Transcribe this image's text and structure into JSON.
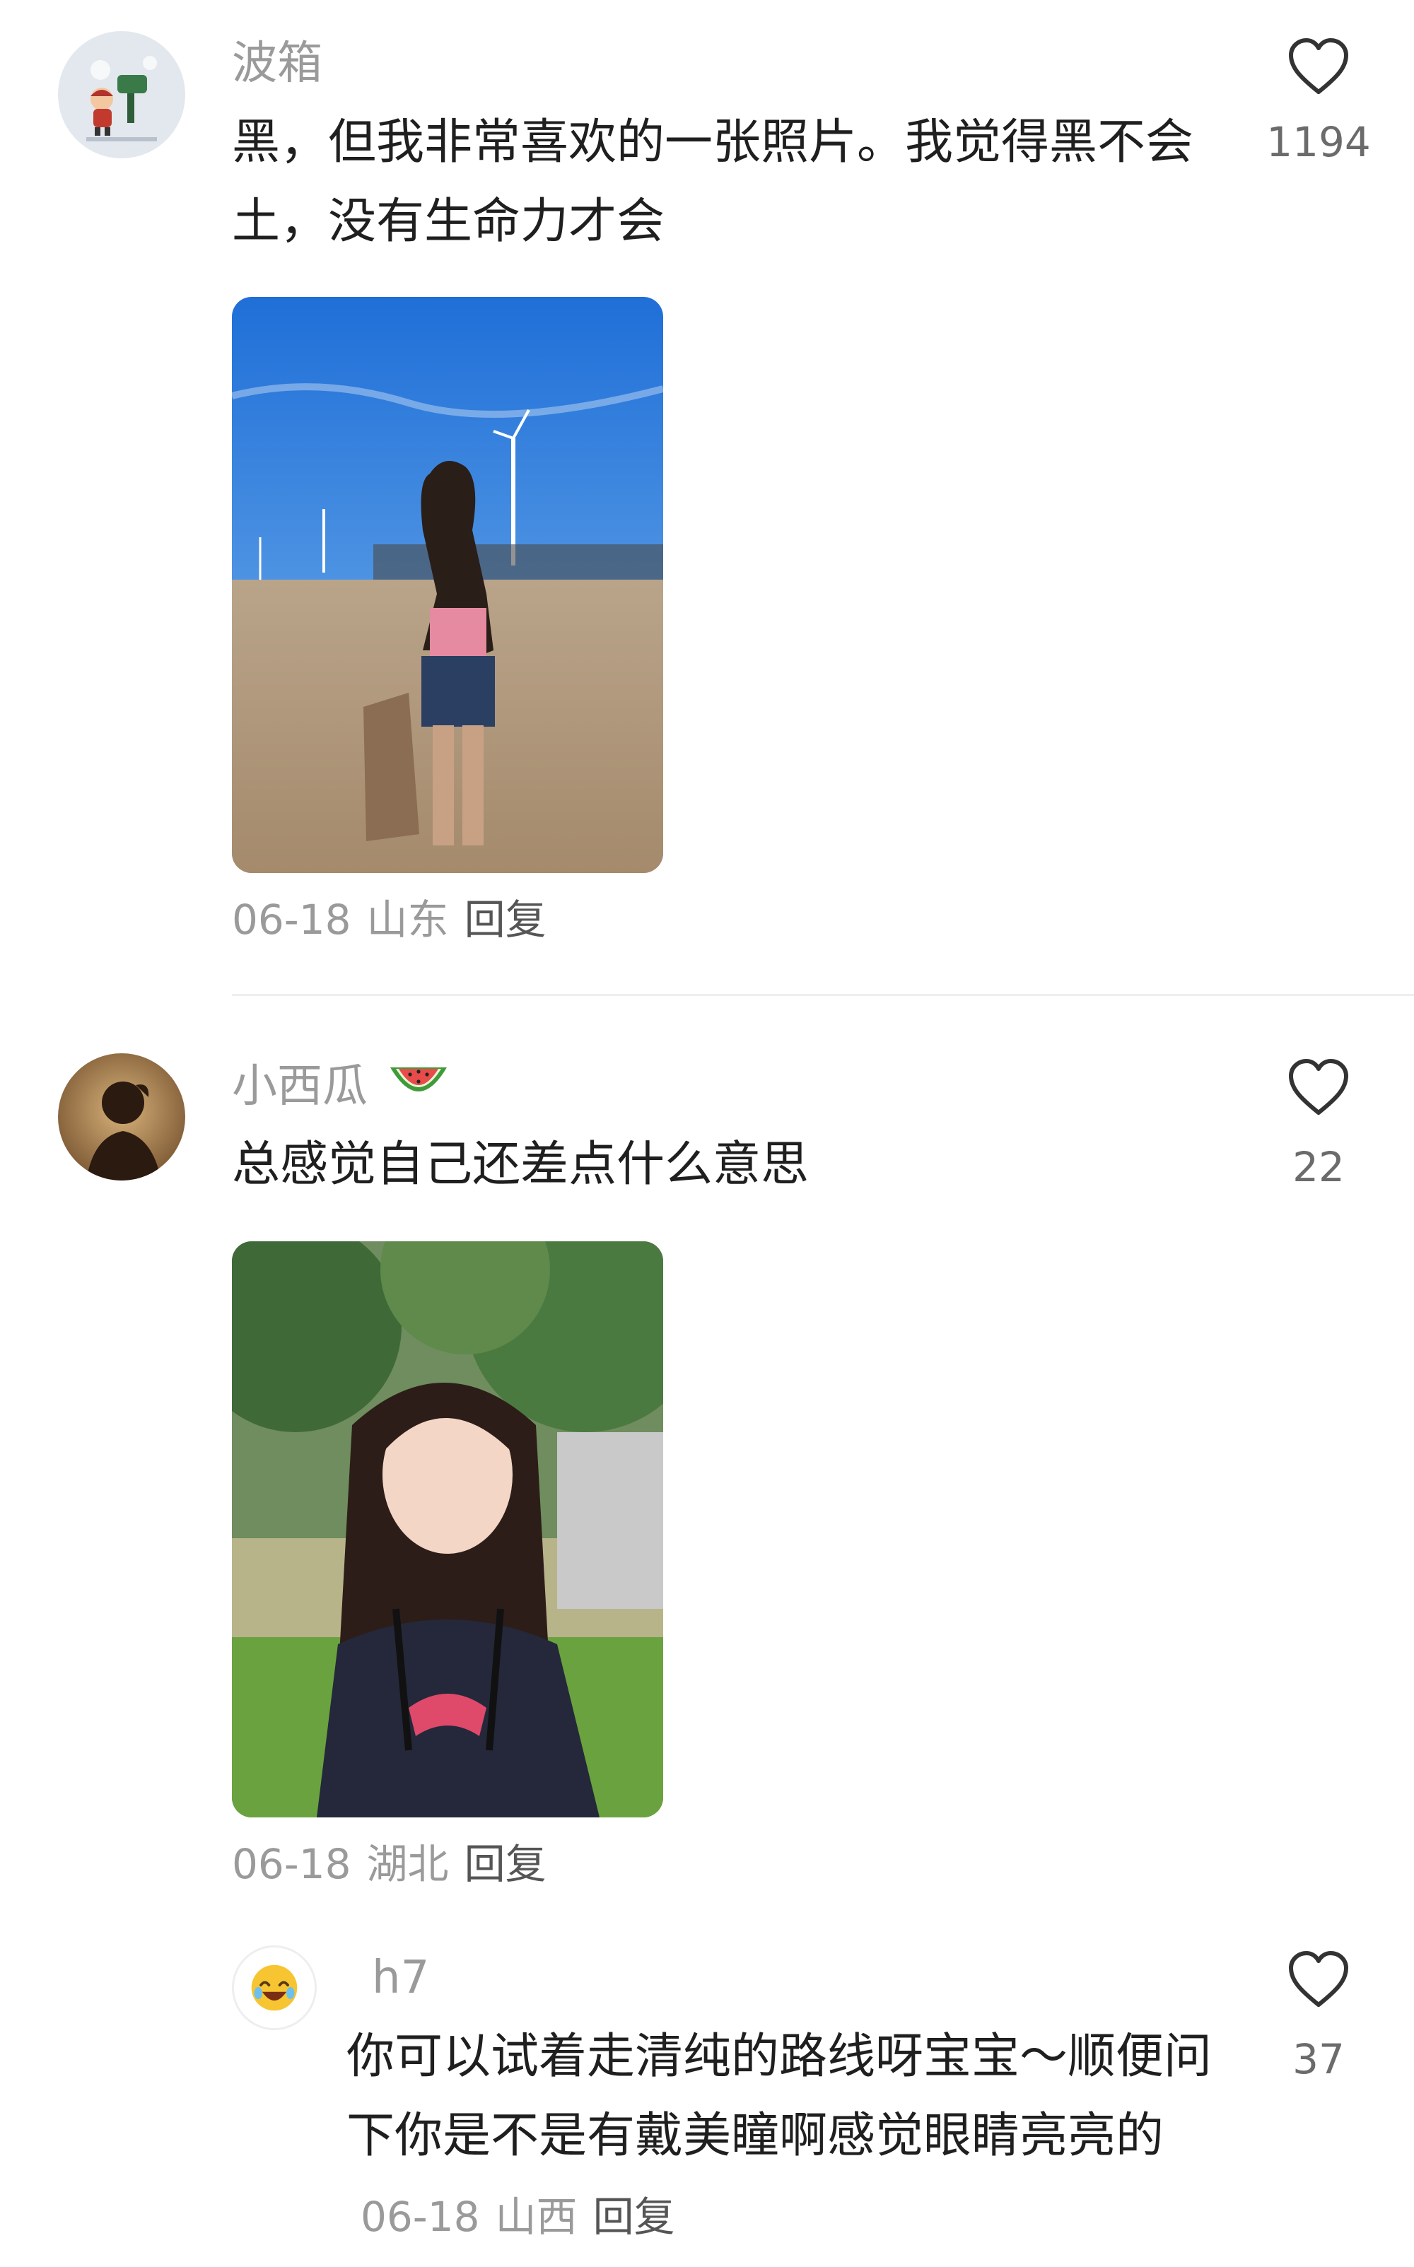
{
  "comments": [
    {
      "username": "波箱",
      "avatar_icon": "cartoon-mailbox-avatar",
      "text": "黑，但我非常喜欢的一张照片。我觉得黑不会土，没有生命力才会",
      "image_alt": "beach-photo-with-wind-turbines",
      "date": "06-18",
      "location": "山东",
      "reply_label": "回复",
      "like_icon": "heart-outline-icon",
      "likes": "1194"
    },
    {
      "username": "小西瓜",
      "username_emoji": "watermelon-icon",
      "avatar_icon": "silhouette-avatar",
      "text": "总感觉自己还差点什么意思",
      "image_alt": "portrait-photo-in-garden",
      "date": "06-18",
      "location": "湖北",
      "reply_label": "回复",
      "like_icon": "heart-outline-icon",
      "likes": "22",
      "replies": [
        {
          "username": "h7",
          "avatar_icon": "laughing-emoji-avatar",
          "text": "你可以试着走清纯的路线呀宝宝～顺便问下你是不是有戴美瞳啊感觉眼睛亮亮的",
          "date": "06-18",
          "location": "山西",
          "reply_label": "回复",
          "like_icon": "heart-outline-icon",
          "likes": "37"
        }
      ]
    }
  ]
}
